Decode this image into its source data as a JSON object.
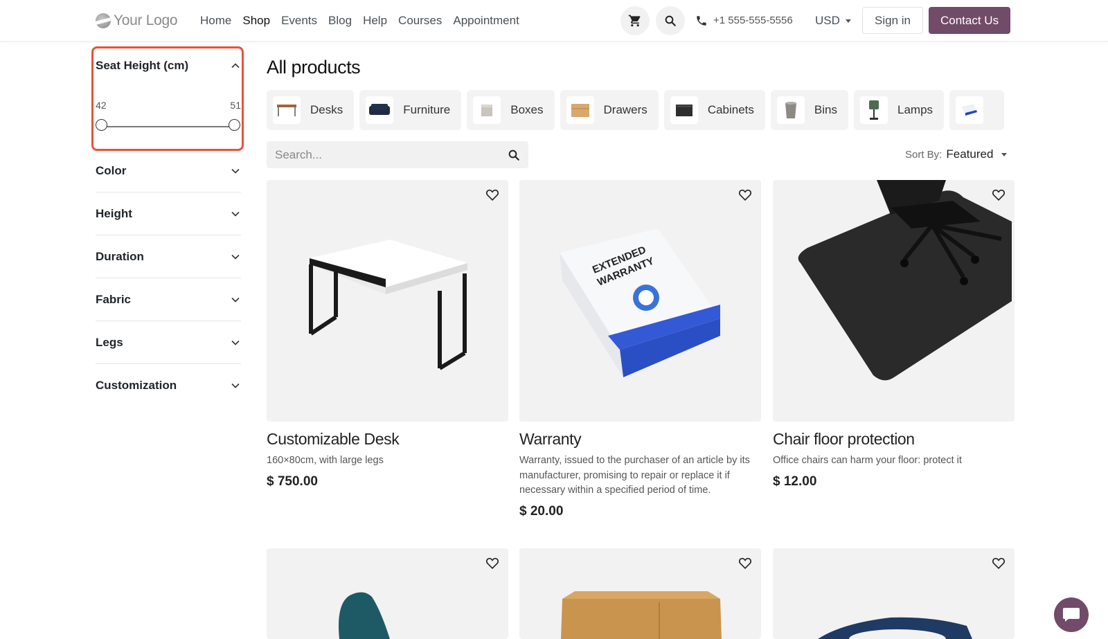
{
  "header": {
    "logo_text": "Your Logo",
    "nav": [
      "Home",
      "Shop",
      "Events",
      "Blog",
      "Help",
      "Courses",
      "Appointment"
    ],
    "active_nav": "Shop",
    "phone": "+1 555-555-5556",
    "currency": "USD",
    "signin": "Sign in",
    "contact": "Contact Us"
  },
  "sidebar": {
    "active_filter": {
      "label": "Seat Height (cm)",
      "min": "42",
      "max": "51"
    },
    "filters": [
      "Color",
      "Height",
      "Duration",
      "Fabric",
      "Legs",
      "Customization"
    ]
  },
  "main": {
    "title": "All products",
    "categories": [
      "Desks",
      "Furniture",
      "Boxes",
      "Drawers",
      "Cabinets",
      "Bins",
      "Lamps"
    ],
    "search_placeholder": "Search...",
    "sort_label": "Sort By:",
    "sort_value": "Featured",
    "products": [
      {
        "name": "Customizable Desk",
        "desc": "160×80cm, with large legs",
        "price": "$ 750.00"
      },
      {
        "name": "Warranty",
        "desc": "Warranty, issued to the purchaser of an article by its manufacturer, promising to repair or replace it if necessary within a specified period of time.",
        "price": "$ 20.00"
      },
      {
        "name": "Chair floor protection",
        "desc": "Office chairs can harm your floor: protect it",
        "price": "$ 12.00"
      }
    ]
  },
  "colors": {
    "brand": "#714b67",
    "highlight": "#e8533a"
  }
}
